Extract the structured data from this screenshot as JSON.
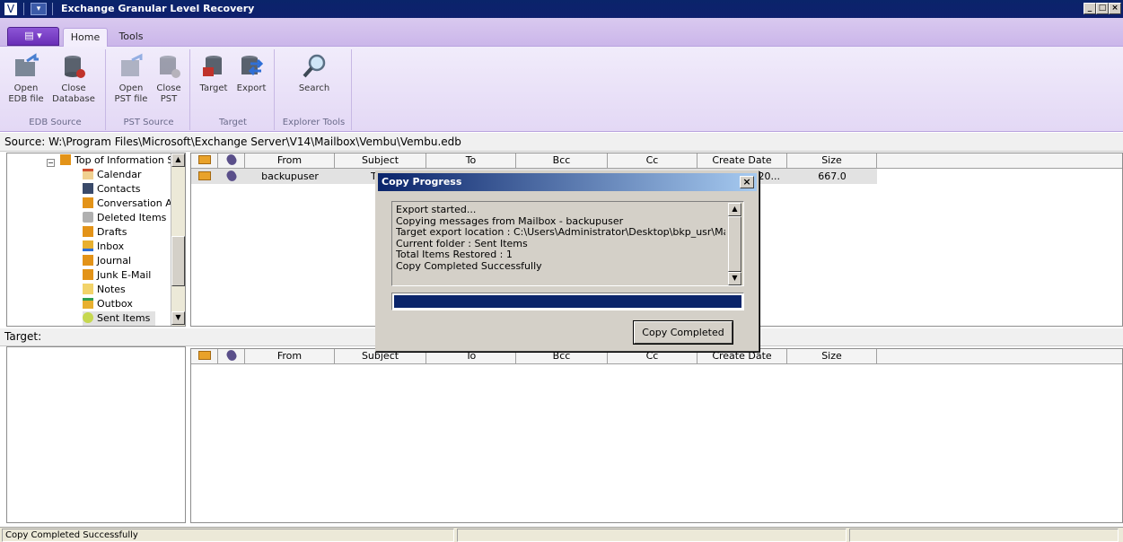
{
  "window": {
    "title": "Exchange Granular Level Recovery",
    "minimize": "_",
    "maximize": "□",
    "close": "×"
  },
  "ribbon": {
    "tabs": [
      {
        "label": "Home"
      },
      {
        "label": "Tools"
      }
    ],
    "groups": [
      {
        "label": "EDB Source",
        "buttons": [
          {
            "label1": "Open",
            "label2": "EDB file"
          },
          {
            "label1": "Close",
            "label2": "Database"
          }
        ]
      },
      {
        "label": "PST Source",
        "buttons": [
          {
            "label1": "Open",
            "label2": "PST file"
          },
          {
            "label1": "Close",
            "label2": "PST"
          }
        ]
      },
      {
        "label": "Target",
        "buttons": [
          {
            "label1": "Target"
          },
          {
            "label1": "Export"
          }
        ]
      },
      {
        "label": "Explorer Tools",
        "buttons": [
          {
            "label1": "Search"
          }
        ]
      }
    ]
  },
  "source_path": "Source: W:\\Program Files\\Microsoft\\Exchange Server\\V14\\Mailbox\\Vembu\\Vembu.edb",
  "tree": {
    "items": [
      {
        "label": "Top of Information S"
      },
      {
        "label": "Calendar"
      },
      {
        "label": "Contacts"
      },
      {
        "label": "Conversation Ac"
      },
      {
        "label": "Deleted Items"
      },
      {
        "label": "Drafts"
      },
      {
        "label": "Inbox"
      },
      {
        "label": "Journal"
      },
      {
        "label": "Junk E-Mail"
      },
      {
        "label": "Notes"
      },
      {
        "label": "Outbox"
      },
      {
        "label": "Sent Items"
      }
    ]
  },
  "grid": {
    "columns": [
      "From",
      "Subject",
      "To",
      "Bcc",
      "Cc",
      "Create Date",
      "Size"
    ],
    "rows": [
      {
        "from": "backupuser",
        "subject": "T",
        "create_date": "20...",
        "size": "667.0"
      }
    ]
  },
  "target_label": "Target:",
  "dialog": {
    "title": "Copy Progress",
    "close": "×",
    "log": [
      "Export started...",
      "Copying messages from Mailbox - backupuser",
      "Target export location : C:\\Users\\Administrator\\Desktop\\bkp_usr\\Mailbox -",
      "Current folder : Sent Items",
      "Total Items Restored : 1",
      "Copy Completed Successfully"
    ],
    "progress": 100,
    "button": "Copy Completed"
  },
  "status": {
    "text": "Copy Completed Successfully"
  }
}
